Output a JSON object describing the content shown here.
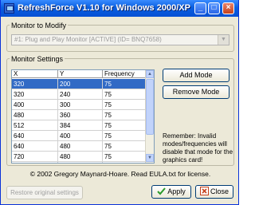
{
  "window": {
    "title": "RefreshForce V1.10 for Windows 2000/XP"
  },
  "titlebar_buttons": {
    "minimize": "_",
    "maximize": "□",
    "close": "×"
  },
  "monitor_group": {
    "label": "Monitor to Modify",
    "selected": "#1: Plug and Play Monitor [ACTIVE] (ID= BNQ7658)"
  },
  "settings_group": {
    "label": "Monitor Settings"
  },
  "table": {
    "columns": [
      "X",
      "Y",
      "Frequency"
    ],
    "rows": [
      [
        "320",
        "200",
        "75"
      ],
      [
        "320",
        "240",
        "75"
      ],
      [
        "400",
        "300",
        "75"
      ],
      [
        "480",
        "360",
        "75"
      ],
      [
        "512",
        "384",
        "75"
      ],
      [
        "640",
        "400",
        "75"
      ],
      [
        "640",
        "480",
        "75"
      ],
      [
        "720",
        "480",
        "75"
      ],
      [
        "720",
        "576",
        "60"
      ]
    ]
  },
  "buttons": {
    "add_mode": "Add Mode",
    "remove_mode": "Remove Mode",
    "restore": "Restore original settings",
    "apply": "Apply",
    "close": "Close"
  },
  "remember": "Remember: Invalid modes/frequencies will disable that mode for the graphics card!",
  "copyright": "© 2002 Gregory Maynard-Hoare.  Read EULA.txt for license.",
  "colors": {
    "accent": "#0a5fe0",
    "selection": "#316ac5",
    "apply_check": "#2a9a2a",
    "close_red": "#c4411c"
  }
}
